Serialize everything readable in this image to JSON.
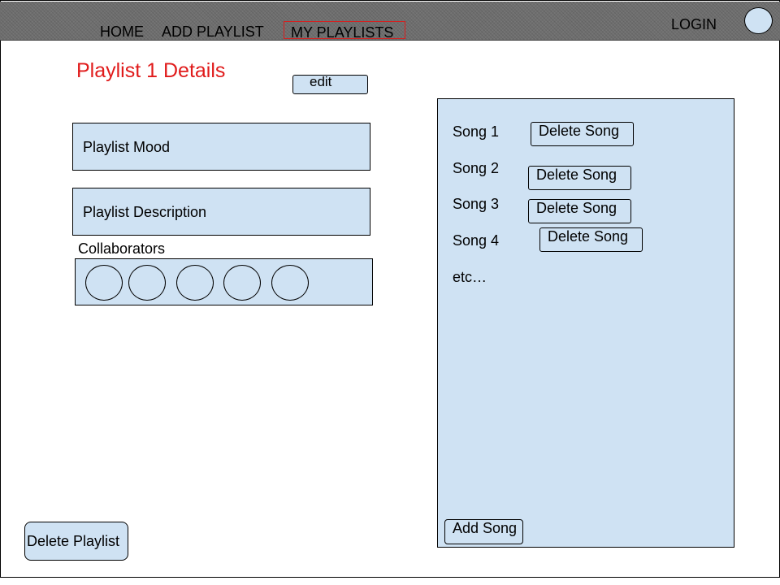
{
  "nav": {
    "home": "HOME",
    "add_playlist": "ADD PLAYLIST",
    "my_playlists": "MY PLAYLISTS",
    "login": "LOGIN"
  },
  "playlist": {
    "title": "Playlist 1 Details",
    "edit_label": "edit",
    "mood": "Playlist Mood",
    "description": "Playlist Description",
    "collaborators_label": "Collaborators",
    "collaborator_count": 5
  },
  "songs": {
    "items": [
      {
        "label": "Song 1",
        "delete_label": "Delete Song"
      },
      {
        "label": "Song 2",
        "delete_label": "Delete Song"
      },
      {
        "label": "Song 3",
        "delete_label": "Delete Song"
      },
      {
        "label": "Song 4",
        "delete_label": "Delete Song"
      }
    ],
    "more": "etc…",
    "add_label": "Add Song"
  },
  "actions": {
    "delete_playlist": "Delete Playlist"
  },
  "colors": {
    "accent": "#e01b1b",
    "panel": "#cfe2f3",
    "topbar": "#6f6f6f"
  }
}
